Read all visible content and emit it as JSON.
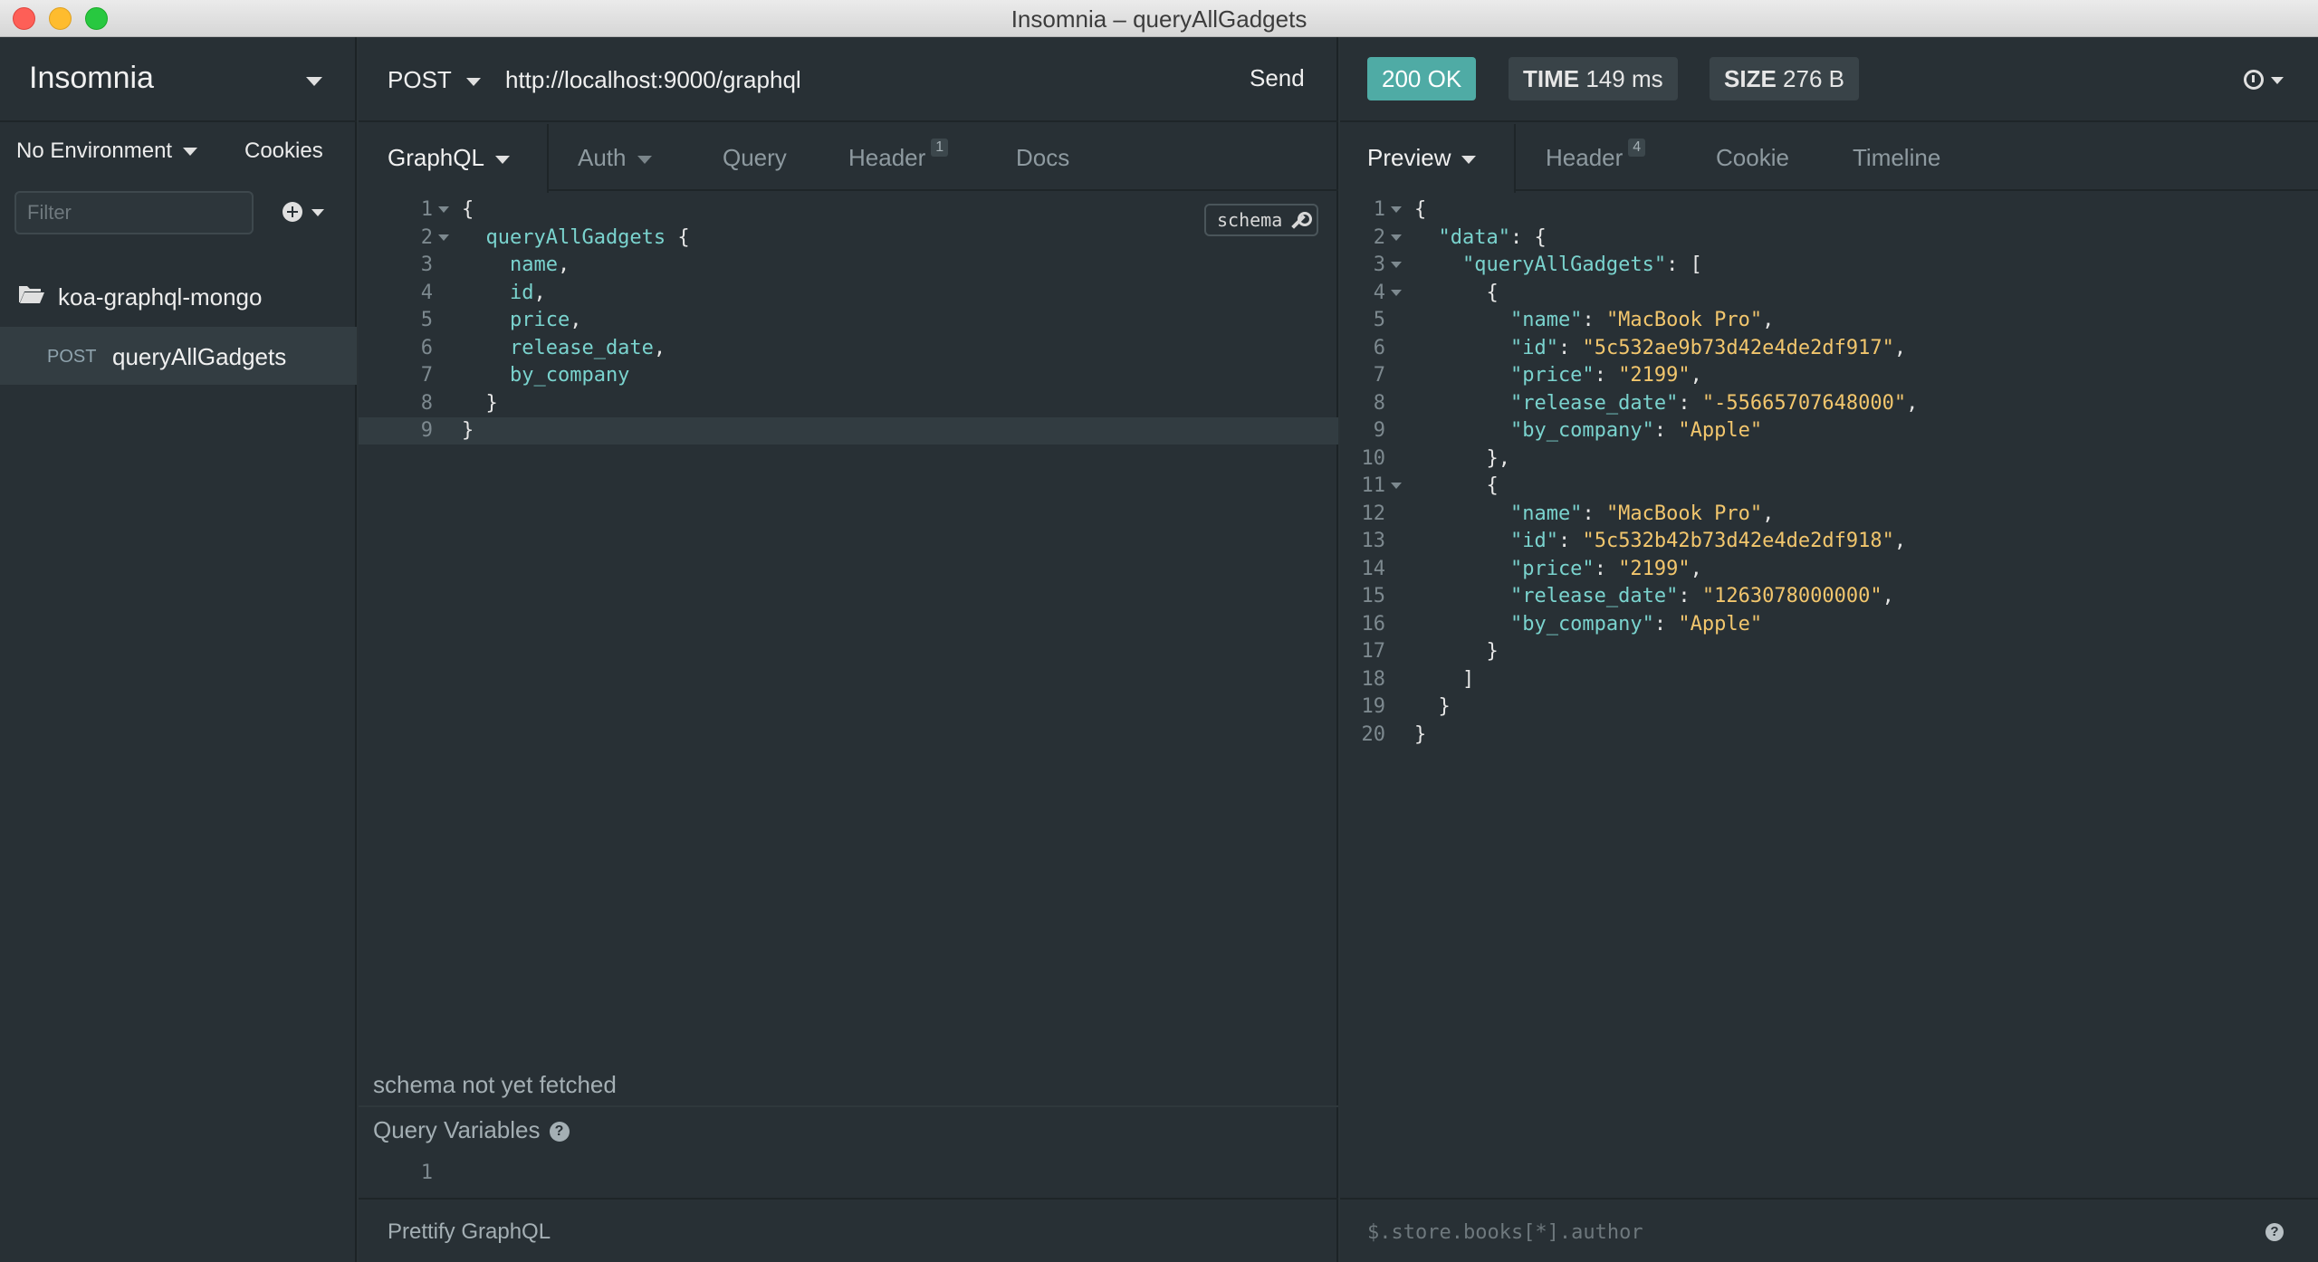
{
  "window": {
    "title": "Insomnia – queryAllGadgets"
  },
  "sidebar": {
    "brand": "Insomnia",
    "environment": "No Environment",
    "cookies": "Cookies",
    "filter_placeholder": "Filter",
    "folder": "koa-graphql-mongo",
    "request": {
      "method": "POST",
      "name": "queryAllGadgets"
    }
  },
  "request": {
    "method": "POST",
    "url": "http://localhost:9000/graphql",
    "send_label": "Send",
    "tabs": [
      {
        "label": "GraphQL",
        "active": true
      },
      {
        "label": "Auth"
      },
      {
        "label": "Query"
      },
      {
        "label": "Header",
        "badge": "1"
      },
      {
        "label": "Docs"
      }
    ],
    "schema_button": "schema",
    "code": [
      {
        "n": "1",
        "parts": [
          [
            "punct",
            "{"
          ]
        ]
      },
      {
        "n": "2",
        "parts": [
          [
            "field",
            "  queryAllGadgets"
          ],
          [
            "punct",
            " {"
          ]
        ]
      },
      {
        "n": "3",
        "parts": [
          [
            "field",
            "    name"
          ],
          [
            "punct",
            ","
          ]
        ]
      },
      {
        "n": "4",
        "parts": [
          [
            "field",
            "    id"
          ],
          [
            "punct",
            ","
          ]
        ]
      },
      {
        "n": "5",
        "parts": [
          [
            "field",
            "    price"
          ],
          [
            "punct",
            ","
          ]
        ]
      },
      {
        "n": "6",
        "parts": [
          [
            "field",
            "    release_date"
          ],
          [
            "punct",
            ","
          ]
        ]
      },
      {
        "n": "7",
        "parts": [
          [
            "field",
            "    by_company"
          ]
        ]
      },
      {
        "n": "8",
        "parts": [
          [
            "punct",
            "  }"
          ]
        ]
      },
      {
        "n": "9",
        "parts": [
          [
            "punct",
            "}"
          ]
        ]
      }
    ],
    "schema_status": "schema not yet fetched",
    "variables_title": "Query Variables",
    "variables_line": "1",
    "prettify_label": "Prettify GraphQL"
  },
  "response": {
    "status": "200 OK",
    "time_label": "TIME",
    "time_value": "149 ms",
    "size_label": "SIZE",
    "size_value": "276 B",
    "tabs": [
      {
        "label": "Preview",
        "active": true
      },
      {
        "label": "Header",
        "badge": "4"
      },
      {
        "label": "Cookie"
      },
      {
        "label": "Timeline"
      }
    ],
    "body": [
      {
        "n": "1",
        "parts": [
          [
            "punct",
            "{"
          ]
        ]
      },
      {
        "n": "2",
        "parts": [
          [
            "key",
            "  \"data\""
          ],
          [
            "punct",
            ": {"
          ]
        ]
      },
      {
        "n": "3",
        "parts": [
          [
            "key",
            "    \"queryAllGadgets\""
          ],
          [
            "punct",
            ": ["
          ]
        ]
      },
      {
        "n": "4",
        "parts": [
          [
            "punct",
            "      {"
          ]
        ]
      },
      {
        "n": "5",
        "parts": [
          [
            "key",
            "        \"name\""
          ],
          [
            "punct",
            ": "
          ],
          [
            "str",
            "\"MacBook Pro\""
          ],
          [
            "punct",
            ","
          ]
        ]
      },
      {
        "n": "6",
        "parts": [
          [
            "key",
            "        \"id\""
          ],
          [
            "punct",
            ": "
          ],
          [
            "str",
            "\"5c532ae9b73d42e4de2df917\""
          ],
          [
            "punct",
            ","
          ]
        ]
      },
      {
        "n": "7",
        "parts": [
          [
            "key",
            "        \"price\""
          ],
          [
            "punct",
            ": "
          ],
          [
            "str",
            "\"2199\""
          ],
          [
            "punct",
            ","
          ]
        ]
      },
      {
        "n": "8",
        "parts": [
          [
            "key",
            "        \"release_date\""
          ],
          [
            "punct",
            ": "
          ],
          [
            "str",
            "\"-55665707648000\""
          ],
          [
            "punct",
            ","
          ]
        ]
      },
      {
        "n": "9",
        "parts": [
          [
            "key",
            "        \"by_company\""
          ],
          [
            "punct",
            ": "
          ],
          [
            "str",
            "\"Apple\""
          ]
        ]
      },
      {
        "n": "10",
        "parts": [
          [
            "punct",
            "      },"
          ]
        ]
      },
      {
        "n": "11",
        "parts": [
          [
            "punct",
            "      {"
          ]
        ]
      },
      {
        "n": "12",
        "parts": [
          [
            "key",
            "        \"name\""
          ],
          [
            "punct",
            ": "
          ],
          [
            "str",
            "\"MacBook Pro\""
          ],
          [
            "punct",
            ","
          ]
        ]
      },
      {
        "n": "13",
        "parts": [
          [
            "key",
            "        \"id\""
          ],
          [
            "punct",
            ": "
          ],
          [
            "str",
            "\"5c532b42b73d42e4de2df918\""
          ],
          [
            "punct",
            ","
          ]
        ]
      },
      {
        "n": "14",
        "parts": [
          [
            "key",
            "        \"price\""
          ],
          [
            "punct",
            ": "
          ],
          [
            "str",
            "\"2199\""
          ],
          [
            "punct",
            ","
          ]
        ]
      },
      {
        "n": "15",
        "parts": [
          [
            "key",
            "        \"release_date\""
          ],
          [
            "punct",
            ": "
          ],
          [
            "str",
            "\"1263078000000\""
          ],
          [
            "punct",
            ","
          ]
        ]
      },
      {
        "n": "16",
        "parts": [
          [
            "key",
            "        \"by_company\""
          ],
          [
            "punct",
            ": "
          ],
          [
            "str",
            "\"Apple\""
          ]
        ]
      },
      {
        "n": "17",
        "parts": [
          [
            "punct",
            "      }"
          ]
        ]
      },
      {
        "n": "18",
        "parts": [
          [
            "punct",
            "    ]"
          ]
        ]
      },
      {
        "n": "19",
        "parts": [
          [
            "punct",
            "  }"
          ]
        ]
      },
      {
        "n": "20",
        "parts": [
          [
            "punct",
            "}"
          ]
        ]
      }
    ],
    "filter_placeholder": "$.store.books[*].author"
  }
}
